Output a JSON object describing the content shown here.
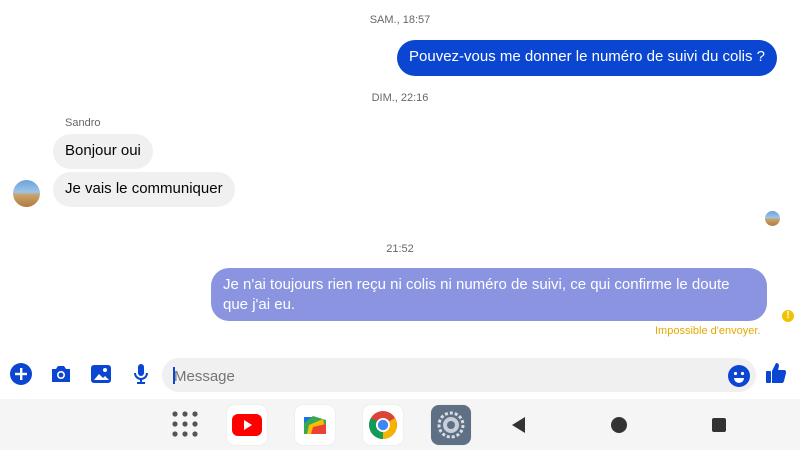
{
  "conversation": {
    "timestamp_1": "SAM., 18:57",
    "message_out_1": "Pouvez-vous me donner le numéro de suivi du colis ?",
    "timestamp_2": "DIM., 22:16",
    "sender_name": "Sandro",
    "message_in_1": "Bonjour oui",
    "message_in_2": "Je vais le communiquer",
    "timestamp_3": "21:52",
    "message_out_2": "Je n'ai toujours rien reçu ni colis ni numéro de suivi, ce qui confirme le doute que j'ai eu.",
    "failed_status": "Impossible d'envoyer.",
    "failed_icon": "!"
  },
  "composer": {
    "placeholder": "Message",
    "icons": [
      "plus-icon",
      "camera-icon",
      "gallery-icon",
      "microphone-icon",
      "emoji-icon",
      "thumbs-up-icon"
    ]
  },
  "navbar": {
    "apps": [
      "app-drawer",
      "youtube",
      "files",
      "chrome",
      "settings"
    ],
    "controls": [
      "back",
      "home",
      "recents"
    ]
  },
  "colors": {
    "brand_blue": "#0a46d1",
    "pending_bubble": "#8a94e0",
    "incoming_bubble": "#f0f0f0",
    "warning": "#e6a800"
  }
}
